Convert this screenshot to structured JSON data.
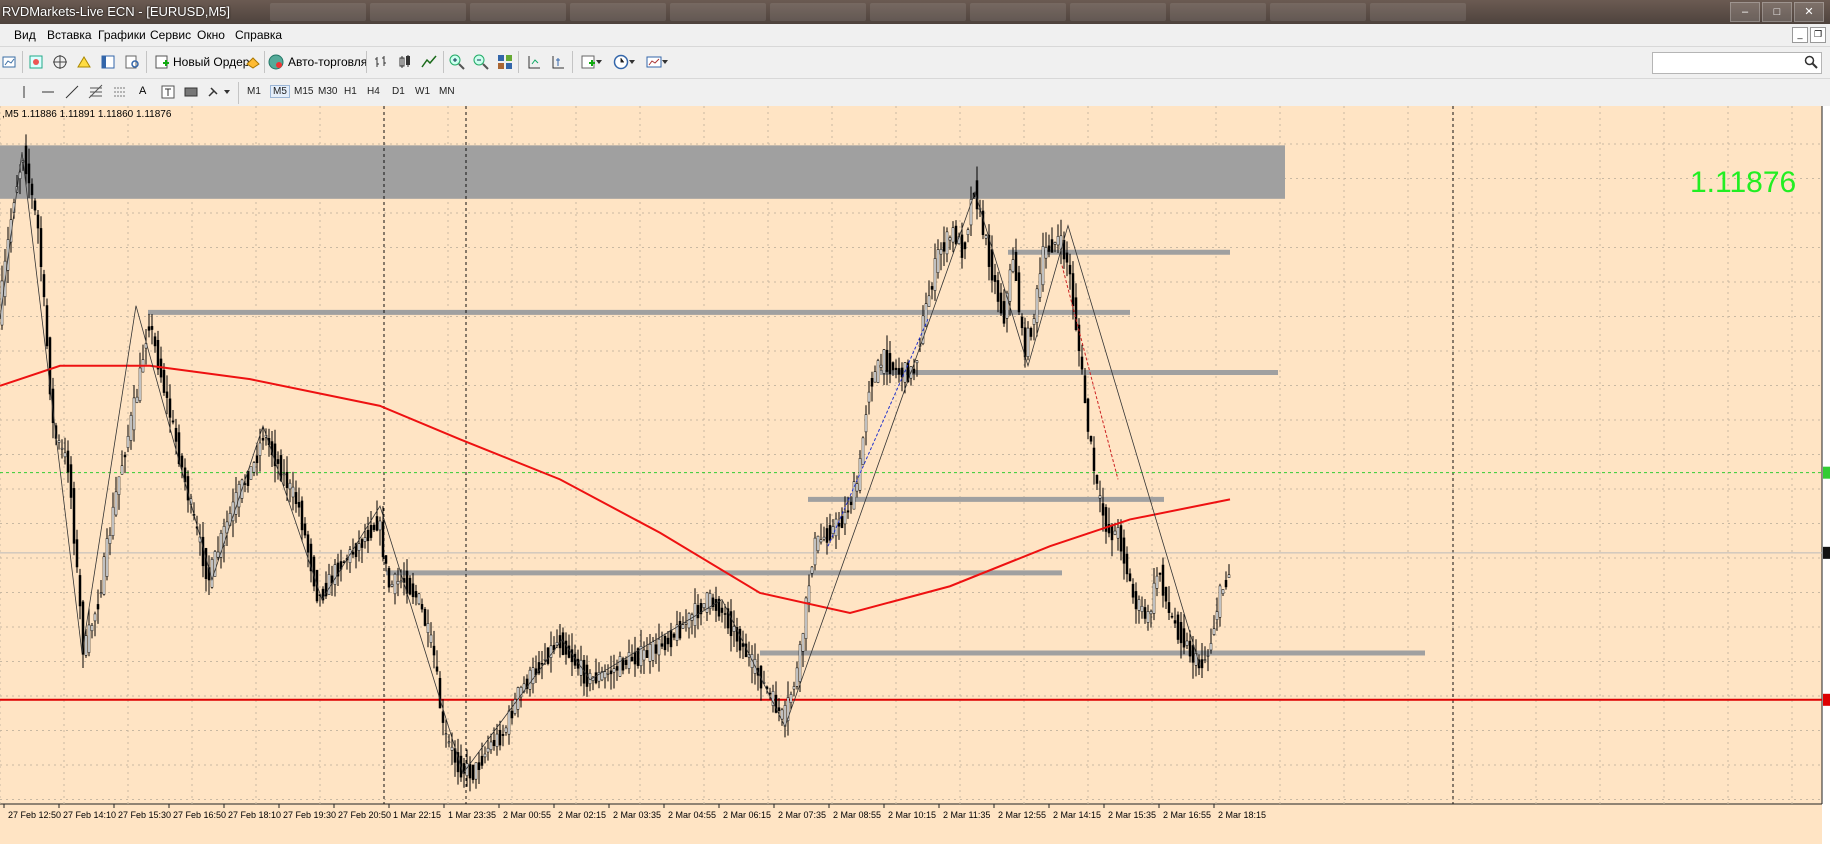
{
  "window": {
    "title": "RVDMarkets-Live ECN - [EURUSD,M5]"
  },
  "menu": [
    {
      "key": "view",
      "label": "Вид"
    },
    {
      "key": "insert",
      "label": "Вставка"
    },
    {
      "key": "charts",
      "label": "Графики"
    },
    {
      "key": "service",
      "label": "Сервис"
    },
    {
      "key": "window",
      "label": "Окно"
    },
    {
      "key": "help",
      "label": "Справка"
    }
  ],
  "toolbar": {
    "new_order": "Новый Ордер",
    "autotrading": "Авто-торговля"
  },
  "timeframes": [
    "M1",
    "M5",
    "M15",
    "M30",
    "H1",
    "H4",
    "D1",
    "W1",
    "MN"
  ],
  "active_timeframe": "M5",
  "drawing_tools": [
    "vertical-line-icon",
    "horizontal-line-icon",
    "trendline-icon",
    "fibonacci-icon",
    "equidistant-channel-icon",
    "text-icon",
    "text-label-icon",
    "rectangle-icon",
    "arrows-icon"
  ],
  "chart": {
    "ohlc_line": ",M5  1.11886 1.11891 1.11860 1.11876",
    "current_price": "1.11876",
    "symbol": "EURUSD",
    "timeframe": "M5",
    "colors": {
      "background": "#ffe4c4",
      "grid": "#c8b8a2",
      "candles": "#000000",
      "moving_average": "#ee1111",
      "support_line": "#dd0000",
      "zones": "#a0a0a0",
      "big_price": "#22ee22",
      "bid_line": "#33cc33"
    }
  },
  "chart_data": {
    "type": "candlestick",
    "x_ticks": [
      "27 Feb 12:50",
      "27 Feb 14:10",
      "27 Feb 15:30",
      "27 Feb 16:50",
      "27 Feb 18:10",
      "27 Feb 19:30",
      "27 Feb 20:50",
      "1 Mar 22:15",
      "1 Mar 23:35",
      "2 Mar 00:55",
      "2 Mar 02:15",
      "2 Mar 03:35",
      "2 Mar 04:55",
      "2 Mar 06:15",
      "2 Mar 07:35",
      "2 Mar 08:55",
      "2 Mar 10:15",
      "2 Mar 11:35",
      "2 Mar 12:55",
      "2 Mar 14:15",
      "2 Mar 15:35",
      "2 Mar 16:55",
      "2 Mar 18:15"
    ],
    "price_path": [
      [
        0,
        0.72
      ],
      [
        15,
        0.9
      ],
      [
        25,
        0.97
      ],
      [
        40,
        0.85
      ],
      [
        55,
        0.55
      ],
      [
        70,
        0.5
      ],
      [
        85,
        0.22
      ],
      [
        100,
        0.3
      ],
      [
        120,
        0.48
      ],
      [
        140,
        0.62
      ],
      [
        150,
        0.72
      ],
      [
        165,
        0.62
      ],
      [
        180,
        0.52
      ],
      [
        195,
        0.42
      ],
      [
        210,
        0.33
      ],
      [
        225,
        0.4
      ],
      [
        240,
        0.46
      ],
      [
        255,
        0.5
      ],
      [
        265,
        0.55
      ],
      [
        280,
        0.5
      ],
      [
        300,
        0.44
      ],
      [
        320,
        0.3
      ],
      [
        340,
        0.35
      ],
      [
        360,
        0.38
      ],
      [
        380,
        0.42
      ],
      [
        390,
        0.32
      ],
      [
        405,
        0.33
      ],
      [
        420,
        0.3
      ],
      [
        435,
        0.22
      ],
      [
        445,
        0.1
      ],
      [
        460,
        0.05
      ],
      [
        475,
        0.04
      ],
      [
        490,
        0.08
      ],
      [
        505,
        0.1
      ],
      [
        520,
        0.16
      ],
      [
        540,
        0.2
      ],
      [
        560,
        0.24
      ],
      [
        575,
        0.21
      ],
      [
        590,
        0.18
      ],
      [
        610,
        0.19
      ],
      [
        630,
        0.21
      ],
      [
        650,
        0.22
      ],
      [
        670,
        0.24
      ],
      [
        690,
        0.27
      ],
      [
        710,
        0.3
      ],
      [
        725,
        0.28
      ],
      [
        740,
        0.24
      ],
      [
        755,
        0.2
      ],
      [
        770,
        0.16
      ],
      [
        785,
        0.12
      ],
      [
        800,
        0.2
      ],
      [
        815,
        0.38
      ],
      [
        830,
        0.4
      ],
      [
        845,
        0.42
      ],
      [
        860,
        0.48
      ],
      [
        870,
        0.62
      ],
      [
        885,
        0.66
      ],
      [
        900,
        0.64
      ],
      [
        915,
        0.64
      ],
      [
        925,
        0.72
      ],
      [
        940,
        0.82
      ],
      [
        955,
        0.85
      ],
      [
        965,
        0.82
      ],
      [
        975,
        0.92
      ],
      [
        985,
        0.85
      ],
      [
        995,
        0.78
      ],
      [
        1005,
        0.72
      ],
      [
        1015,
        0.82
      ],
      [
        1025,
        0.67
      ],
      [
        1035,
        0.72
      ],
      [
        1045,
        0.82
      ],
      [
        1060,
        0.84
      ],
      [
        1070,
        0.8
      ],
      [
        1080,
        0.68
      ],
      [
        1090,
        0.55
      ],
      [
        1100,
        0.45
      ],
      [
        1110,
        0.4
      ],
      [
        1120,
        0.4
      ],
      [
        1135,
        0.3
      ],
      [
        1150,
        0.27
      ],
      [
        1160,
        0.35
      ],
      [
        1170,
        0.28
      ],
      [
        1185,
        0.24
      ],
      [
        1200,
        0.2
      ],
      [
        1210,
        0.22
      ],
      [
        1220,
        0.3
      ],
      [
        1230,
        0.34
      ]
    ],
    "moving_average": [
      [
        0,
        0.62
      ],
      [
        60,
        0.65
      ],
      [
        150,
        0.65
      ],
      [
        250,
        0.63
      ],
      [
        380,
        0.59
      ],
      [
        460,
        0.54
      ],
      [
        560,
        0.48
      ],
      [
        660,
        0.4
      ],
      [
        760,
        0.31
      ],
      [
        850,
        0.28
      ],
      [
        950,
        0.32
      ],
      [
        1050,
        0.38
      ],
      [
        1130,
        0.42
      ],
      [
        1230,
        0.45
      ]
    ],
    "zigzag": [
      [
        0,
        0.72
      ],
      [
        22,
        0.97
      ],
      [
        82,
        0.22
      ],
      [
        136,
        0.74
      ],
      [
        212,
        0.33
      ],
      [
        263,
        0.56
      ],
      [
        322,
        0.3
      ],
      [
        380,
        0.44
      ],
      [
        463,
        0.04
      ],
      [
        562,
        0.24
      ],
      [
        590,
        0.18
      ],
      [
        722,
        0.3
      ],
      [
        785,
        0.11
      ],
      [
        975,
        0.91
      ],
      [
        1028,
        0.65
      ],
      [
        1068,
        0.86
      ],
      [
        1200,
        0.2
      ]
    ],
    "horizontal_segments": [
      {
        "x1": 148,
        "x2": 1130,
        "y": 0.73
      },
      {
        "x1": 1008,
        "x2": 1230,
        "y": 0.82
      },
      {
        "x1": 880,
        "x2": 1278,
        "y": 0.64
      },
      {
        "x1": 808,
        "x2": 1164,
        "y": 0.45
      },
      {
        "x1": 386,
        "x2": 1062,
        "y": 0.34
      },
      {
        "x1": 760,
        "x2": 1425,
        "y": 0.22
      }
    ],
    "zone": {
      "x1": 0,
      "x2": 1285,
      "y_top": 0.98,
      "y_bottom": 0.9
    },
    "support_level_y": 0.15,
    "bid_level_y": 0.49,
    "current_level_y": 0.37,
    "vertical_separators_x": [
      384,
      466,
      1453
    ]
  }
}
